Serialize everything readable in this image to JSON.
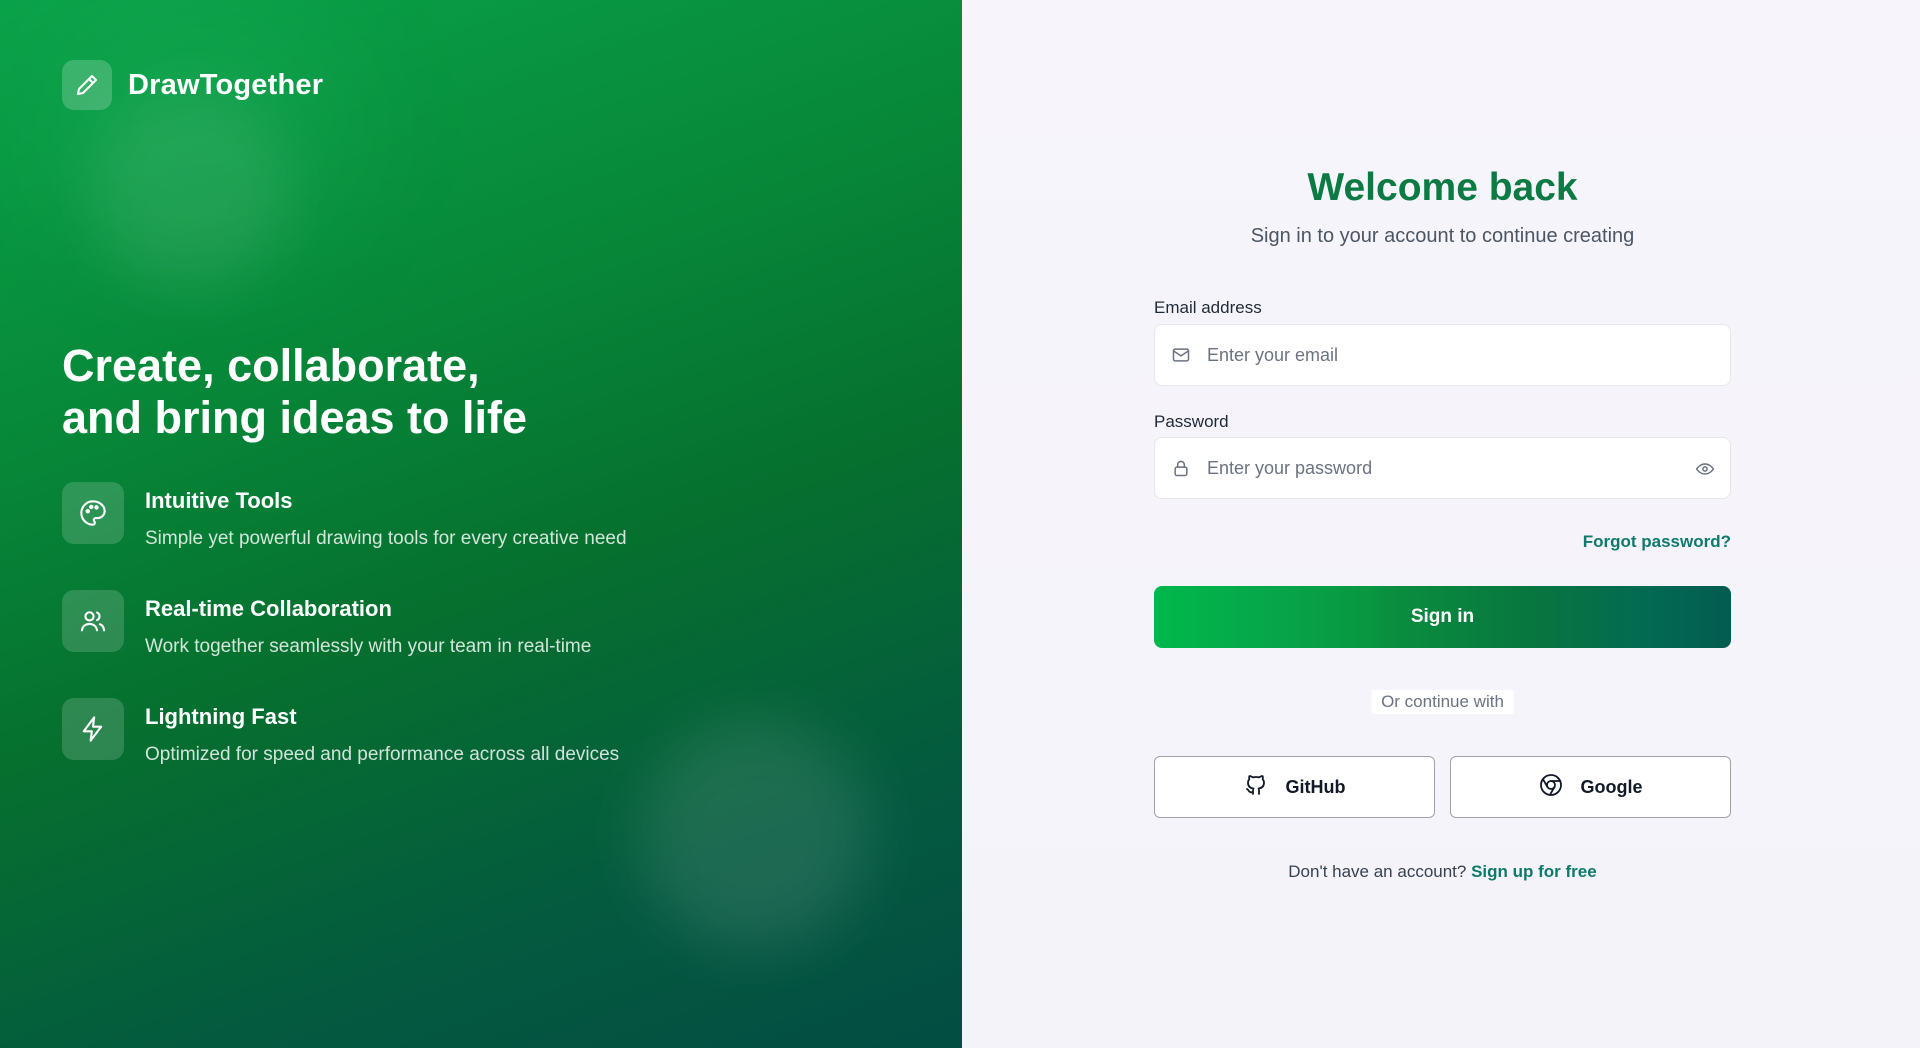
{
  "brand": {
    "name": "DrawTogether",
    "icon": "pencil-icon"
  },
  "hero": {
    "headline_line1": "Create, collaborate,",
    "headline_line2": "and bring ideas to life",
    "features": [
      {
        "title": "Intuitive Tools",
        "description": "Simple yet powerful drawing tools for every creative need",
        "icon": "palette-icon"
      },
      {
        "title": "Real-time Collaboration",
        "description": "Work together seamlessly with your team in real-time",
        "icon": "users-icon"
      },
      {
        "title": "Lightning Fast",
        "description": "Optimized for speed and performance across all devices",
        "icon": "lightning-icon"
      }
    ]
  },
  "form": {
    "title": "Welcome back",
    "subtitle": "Sign in to your account to continue creating",
    "email_label": "Email address",
    "email_placeholder": "Enter your email",
    "email_value": "",
    "password_label": "Password",
    "password_placeholder": "Enter your password",
    "password_value": "",
    "forgot_label": "Forgot password?",
    "signin_label": "Sign in",
    "divider_label": "Or continue with",
    "github_label": "GitHub",
    "google_label": "Google",
    "signup_prompt": "Don't have an account?",
    "signup_link": "Sign up for free"
  },
  "colors": {
    "accent": "#0b7a43",
    "link": "#0e7a6b",
    "hero_start": "#0aa24a",
    "hero_end": "#034d43"
  }
}
